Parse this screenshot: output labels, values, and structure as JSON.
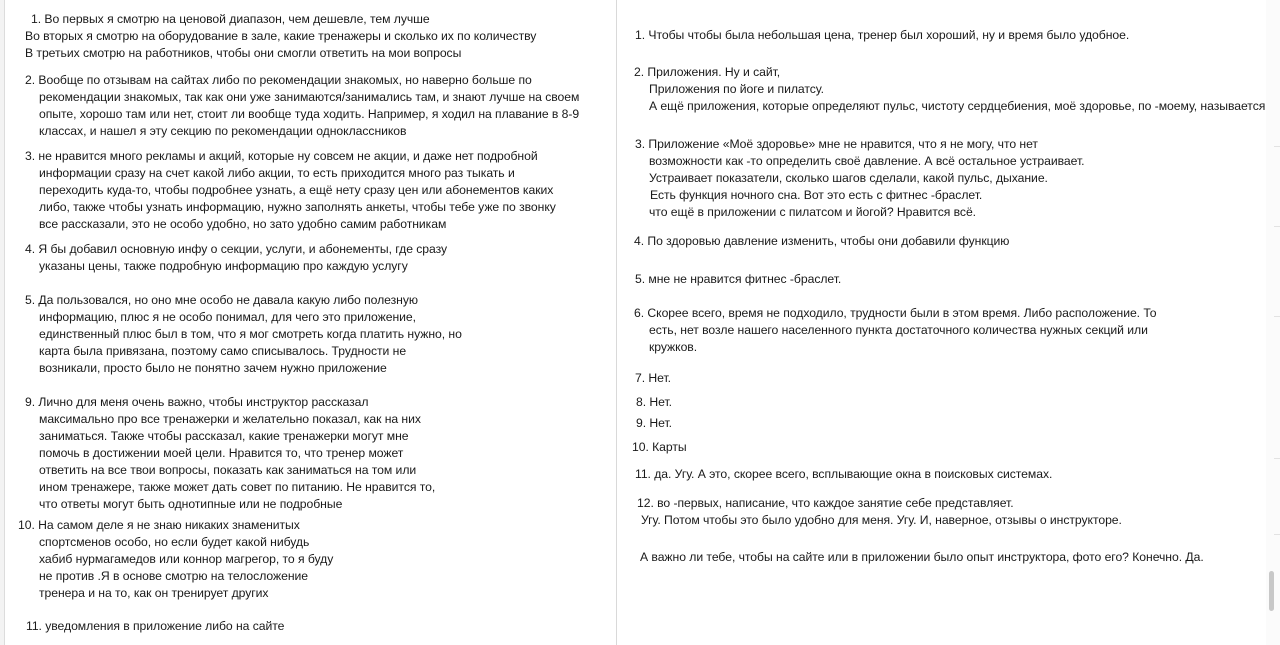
{
  "left_answers": [
    [
      "1. Во первых я смотрю на ценовой диапазон, чем дешевле, тем лучше",
      "Во вторых я смотрю на оборудование в зале, какие тренажеры и сколько их по количеству",
      "В третьих смотрю на работников, чтобы они смогли ответить на мои вопросы"
    ],
    [
      "2. Вообще по отзывам на сайтах либо по рекомендации знакомых, но наверно больше по",
      "рекомендации знакомых, так как они уже занимаются/занимались там, и знают лучше на своем",
      "опыте, хорошо там или нет, стоит ли вообще туда ходить. Например, я ходил на плавание в 8-9",
      "классах, и нашел я эту секцию по рекомендации одноклассников"
    ],
    [
      "3. не нравится много рекламы и акций, которые ну совсем не акции, и даже нет подробной",
      "информации сразу на счет какой либо акции, то есть приходится много раз тыкать и",
      "переходить куда-то, чтобы подробнее узнать, а ещё нету сразу цен или абонементов каких",
      "либо, также чтобы узнать информацию, нужно заполнять анкеты, чтобы тебе уже по звонку",
      "все рассказали, это не особо удобно, но зато удобно самим работникам"
    ],
    [
      "4. Я бы добавил основную инфу о секции, услуги, и абонементы, где сразу",
      "указаны цены, также подробную информацию про каждую услугу"
    ],
    [
      "5. Да пользовался, но оно мне особо не давала какую либо полезную",
      "информацию, плюс я не особо понимал, для чего это приложение,",
      "единственный плюс был в том, что я мог смотреть когда платить нужно, но",
      "карта была привязана, поэтому само списывалось. Трудности не",
      "возникали, просто было не понятно зачем нужно приложение"
    ],
    [
      "9. Лично для меня очень важно, чтобы инструктор рассказал",
      "максимально про все тренажерки и желательно показал, как на них",
      "заниматься. Также чтобы рассказал, какие тренажерки могут мне",
      "помочь в достижении моей цели. Нравится то, что тренер может",
      "ответить на все твои вопросы, показать как заниматься на том или",
      "ином тренажере, также может дать совет по питанию. Не нравится то,",
      "что ответы могут быть однотипные или не подробные"
    ],
    [
      "10. На самом деле я не знаю никаких знаменитых",
      "спортсменов особо, но если будет какой нибудь",
      "хабиб нурмагамедов или коннор магрегор, то я буду",
      "не против .Я в основе смотрю на телосложение",
      "тренера и на то, как он тренирует других"
    ],
    [
      "11. уведомления в приложение либо на сайте"
    ]
  ],
  "right_answers": [
    [
      "1. Чтобы  чтобы была небольшая цена, тренер был хороший, ну и время было удобное."
    ],
    [
      "2. Приложения. Ну и сайт,",
      "Приложения по йоге и пилатсу.",
      "А ещё приложения, которые определяют пульс, чистоту сердцебиения, моё здоровье, по -моему, называется"
    ],
    [
      "3. Приложение «Моё здоровье» мне не нравится, что я не могу, что нет",
      "возможности как -то определить своё давление. А всё остальное устраивает.",
      "Устраивает показатели, сколько шагов сделали, какой пульс, дыхание.",
      "Есть функция ночного сна. Вот это есть с фитнес -браслет.",
      "что ещё в приложении с пилатсом и йогой? Нравится всё."
    ],
    [
      "4. По здоровью давление изменить, чтобы они добавили функцию"
    ],
    [
      "5. мне не нравится фитнес -браслет."
    ],
    [
      "6. Скорее всего, время не подходило, трудности были в этом время. Либо расположение. То",
      "есть, нет возле нашего населенного пункта достаточного количества нужных секций или",
      "кружков."
    ],
    [
      "7. Нет."
    ],
    [
      "8. Нет."
    ],
    [
      "9. Нет."
    ],
    [
      "10. Карты"
    ],
    [
      "11. да. Угу. А это, скорее всего, всплывающие окна в поисковых системах."
    ],
    [
      "12. во -первых, написание, что каждое занятие себе представляет.",
      "Угу. Потом  чтобы это было удобно для меня. Угу. И, наверное, отзывы о инструкторе."
    ],
    [
      "А важно ли тебе, чтобы на сайте или в приложении было опыт инструктора, фото его? Конечно. Да."
    ]
  ]
}
